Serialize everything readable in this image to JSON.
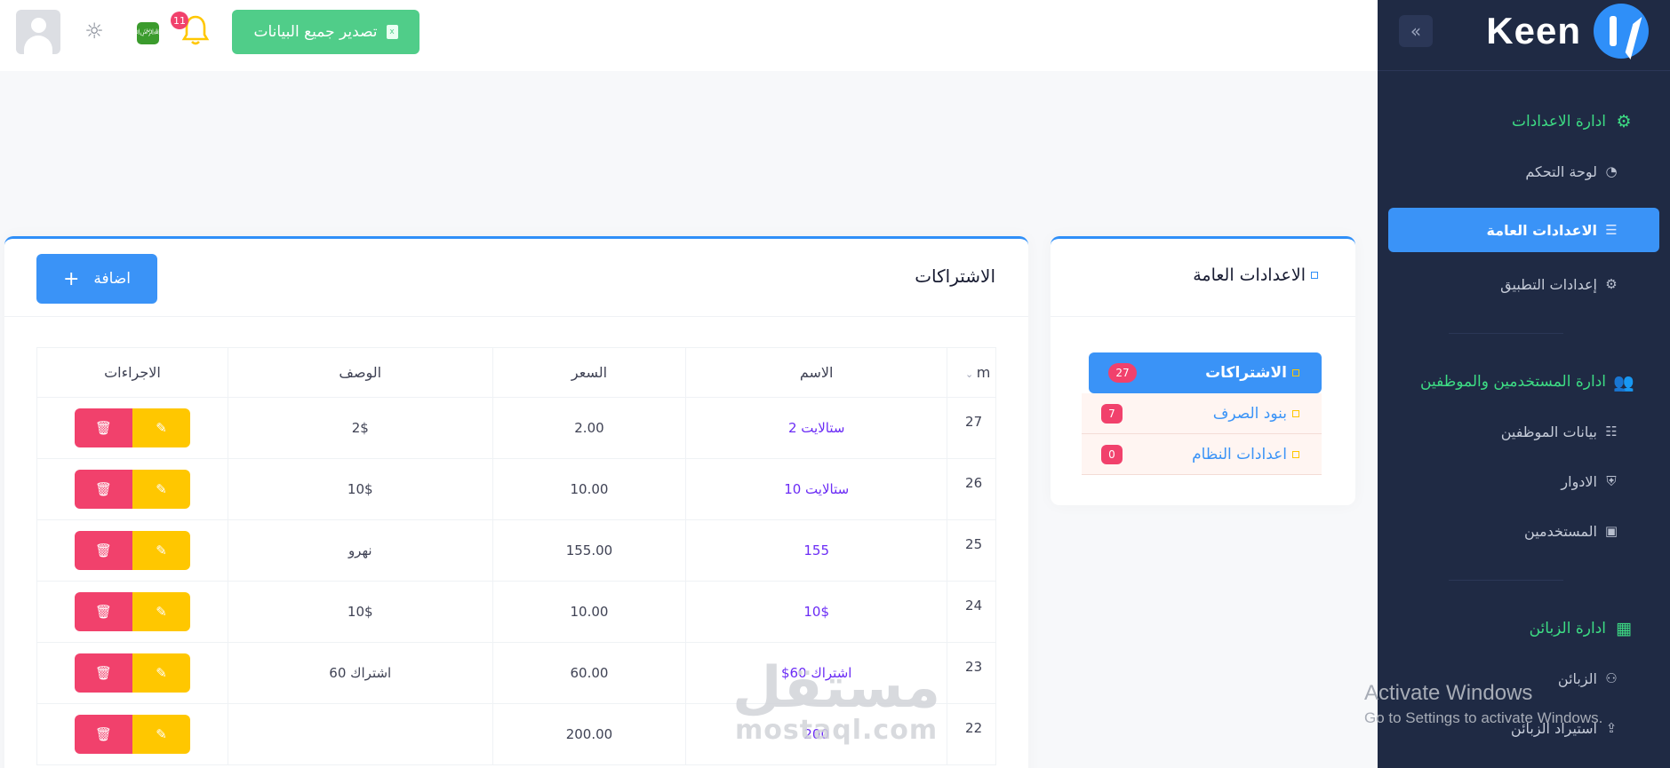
{
  "brand": {
    "name": "Keen"
  },
  "topbar": {
    "export_label": "تصدير جميع البيانات",
    "notification_count": "11",
    "flag_label": "العربية",
    "icons": [
      "user-avatar",
      "sun-icon",
      "saudi-flag-icon",
      "bell-icon",
      "excel-file-icon"
    ]
  },
  "sidebar": {
    "sections": [
      {
        "title": "ادارة الاعدادات",
        "icon": "gear-icon",
        "items": [
          {
            "label": "لوحة التحكم",
            "icon": "gauge-icon",
            "active": false
          },
          {
            "label": "الاعدادات العامة",
            "icon": "sliders-icon",
            "active": true
          },
          {
            "label": "إعدادات التطبيق",
            "icon": "gear-outline-icon",
            "active": false
          }
        ]
      },
      {
        "title": "ادارة المستخدمين والموظفين",
        "icon": "users-icon",
        "items": [
          {
            "label": "بيانات الموظفين",
            "icon": "user-list-icon",
            "active": false
          },
          {
            "label": "الادوار",
            "icon": "shield-icon",
            "active": false
          },
          {
            "label": "المستخدمين",
            "icon": "clipboard-icon",
            "active": false
          }
        ]
      },
      {
        "title": "ادارة الزبائن",
        "icon": "building-icon",
        "items": [
          {
            "label": "الزبائن",
            "icon": "people-icon",
            "active": false
          },
          {
            "label": "استيراد الزبائن",
            "icon": "file-import-icon",
            "active": false
          }
        ]
      }
    ]
  },
  "settings_card": {
    "title": "الاعدادات العامة",
    "items": [
      {
        "label": "الاشتراكات",
        "count": "27",
        "active": true
      },
      {
        "label": "بنود الصرف",
        "count": "7",
        "active": false
      },
      {
        "label": "اعدادات النظام",
        "count": "0",
        "active": false
      }
    ]
  },
  "subscriptions": {
    "title": "الاشتراكات",
    "add_label": "اضافة",
    "columns": {
      "id": "m",
      "name": "الاسم",
      "price": "السعر",
      "description": "الوصف",
      "actions": "الاجراءات"
    },
    "rows": [
      {
        "id": "27",
        "name": "ستالايت 2",
        "price": "2.00",
        "description": "2$"
      },
      {
        "id": "26",
        "name": "ستالايت 10",
        "price": "10.00",
        "description": "10$"
      },
      {
        "id": "25",
        "name": "155",
        "price": "155.00",
        "description": "نهرو"
      },
      {
        "id": "24",
        "name": "10$",
        "price": "10.00",
        "description": "10$"
      },
      {
        "id": "23",
        "name": "اشتراك 60$",
        "price": "60.00",
        "description": "اشتراك 60"
      },
      {
        "id": "22",
        "name": "200",
        "price": "200.00",
        "description": ""
      }
    ]
  },
  "watermarks": {
    "activate_title": "Activate Windows",
    "activate_sub": "Go to Settings to activate Windows.",
    "mostaql_ar": "مستقل",
    "mostaql_en": "mostaql.com"
  },
  "colors": {
    "accent": "#3a93f7",
    "success": "#50cd89",
    "danger": "#f1416c",
    "warning": "#ffc700",
    "sidebar": "#1f2a44",
    "section": "#3ddc84"
  }
}
